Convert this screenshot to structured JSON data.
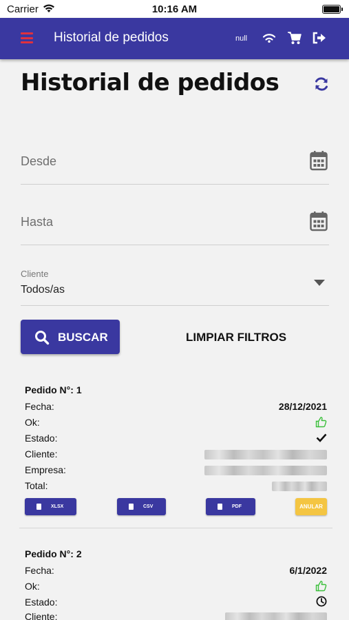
{
  "status_bar": {
    "carrier": "Carrier",
    "time": "10:16 AM"
  },
  "app_bar": {
    "title": "Historial de pedidos",
    "user_text": "null"
  },
  "page": {
    "title": "Historial de pedidos"
  },
  "filters": {
    "desde_placeholder": "Desde",
    "hasta_placeholder": "Hasta",
    "cliente_label": "Cliente",
    "cliente_value": "Todos/as",
    "search_button": "BUSCAR",
    "clear_button": "LIMPIAR FILTROS"
  },
  "labels": {
    "fecha": "Fecha:",
    "ok": "Ok:",
    "estado": "Estado:",
    "cliente": "Cliente:",
    "empresa": "Empresa:",
    "total": "Total:"
  },
  "orders": [
    {
      "header": "Pedido N°: 1",
      "fecha": "28/12/2021",
      "ok_icon": "thumbs-up-icon",
      "estado_icon": "check-icon",
      "actions": {
        "xlsx": "XLSX",
        "csv": "CSV",
        "pdf": "PDF",
        "anular": "ANULAR"
      }
    },
    {
      "header": "Pedido N°: 2",
      "fecha": "6/1/2022",
      "ok_icon": "thumbs-up-icon",
      "estado_icon": "clock-icon"
    }
  ],
  "colors": {
    "primary": "#3a38a0",
    "menu_icon": "#e0313d",
    "ok_green": "#3bbf3b",
    "anular": "#f4c542"
  }
}
